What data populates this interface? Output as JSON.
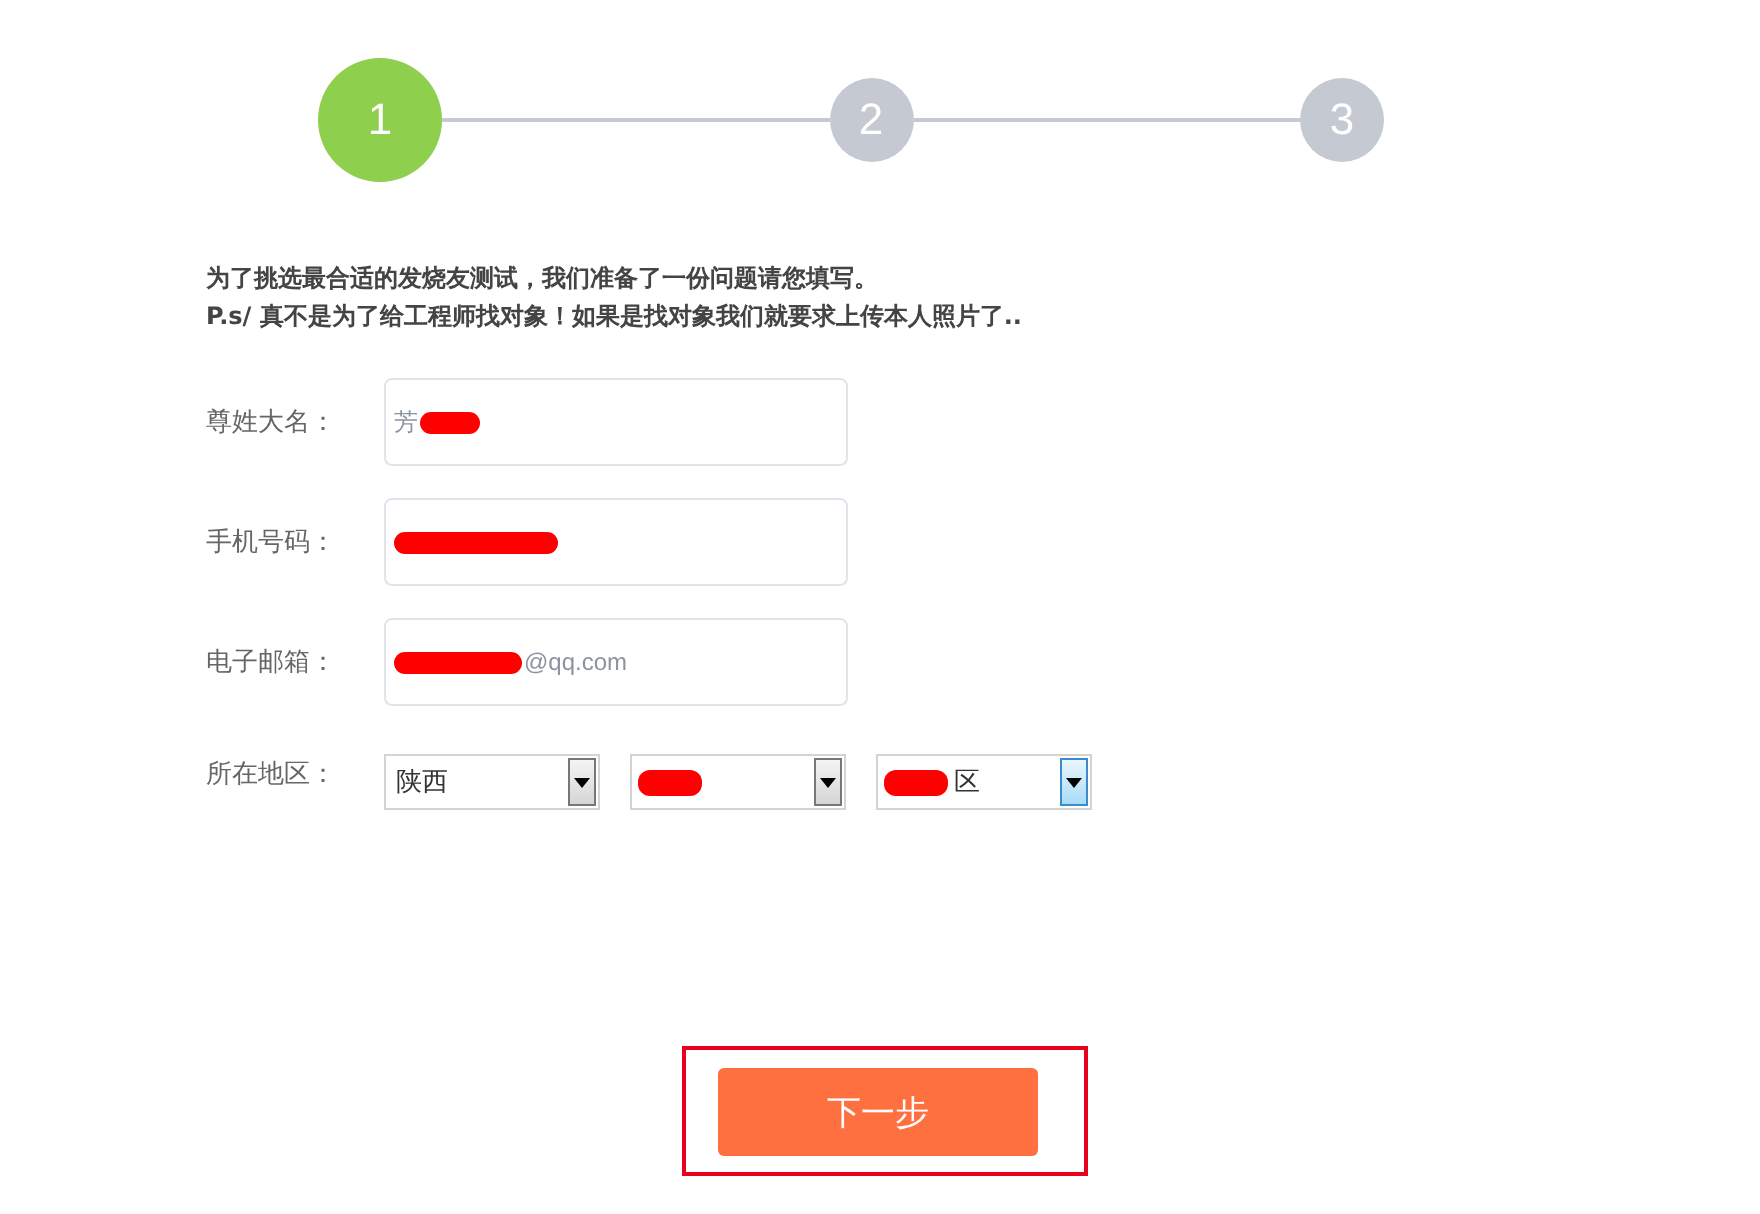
{
  "steps": [
    {
      "label": "1",
      "selected": true
    },
    {
      "label": "2",
      "selected": false
    },
    {
      "label": "3",
      "selected": false
    }
  ],
  "intro": [
    "为了挑选最合适的发烧友测试，我们准备了一份问题请您填写。",
    "P.s/ 真不是为了给工程师找对象！如果是找对象我们就要求上传本人照片了.."
  ],
  "fields": [
    {
      "label": "尊姓大名：",
      "value": "芳",
      "redacted": true,
      "redaction_first": false
    },
    {
      "label": "手机号码：",
      "redacted": true,
      "redaction_first": true
    },
    {
      "label": "电子邮箱：",
      "value": "@qq.com",
      "redacted": true,
      "redaction_first": true
    }
  ],
  "region": {
    "label": "所在地区：",
    "selects": [
      {
        "value": "陕西",
        "redacted": false,
        "focused": false
      },
      {
        "redacted": true,
        "focused": false
      },
      {
        "value": "区",
        "redacted": true,
        "focused": true
      }
    ]
  },
  "next_button": {
    "label": "下一步",
    "highlighted": true
  }
}
